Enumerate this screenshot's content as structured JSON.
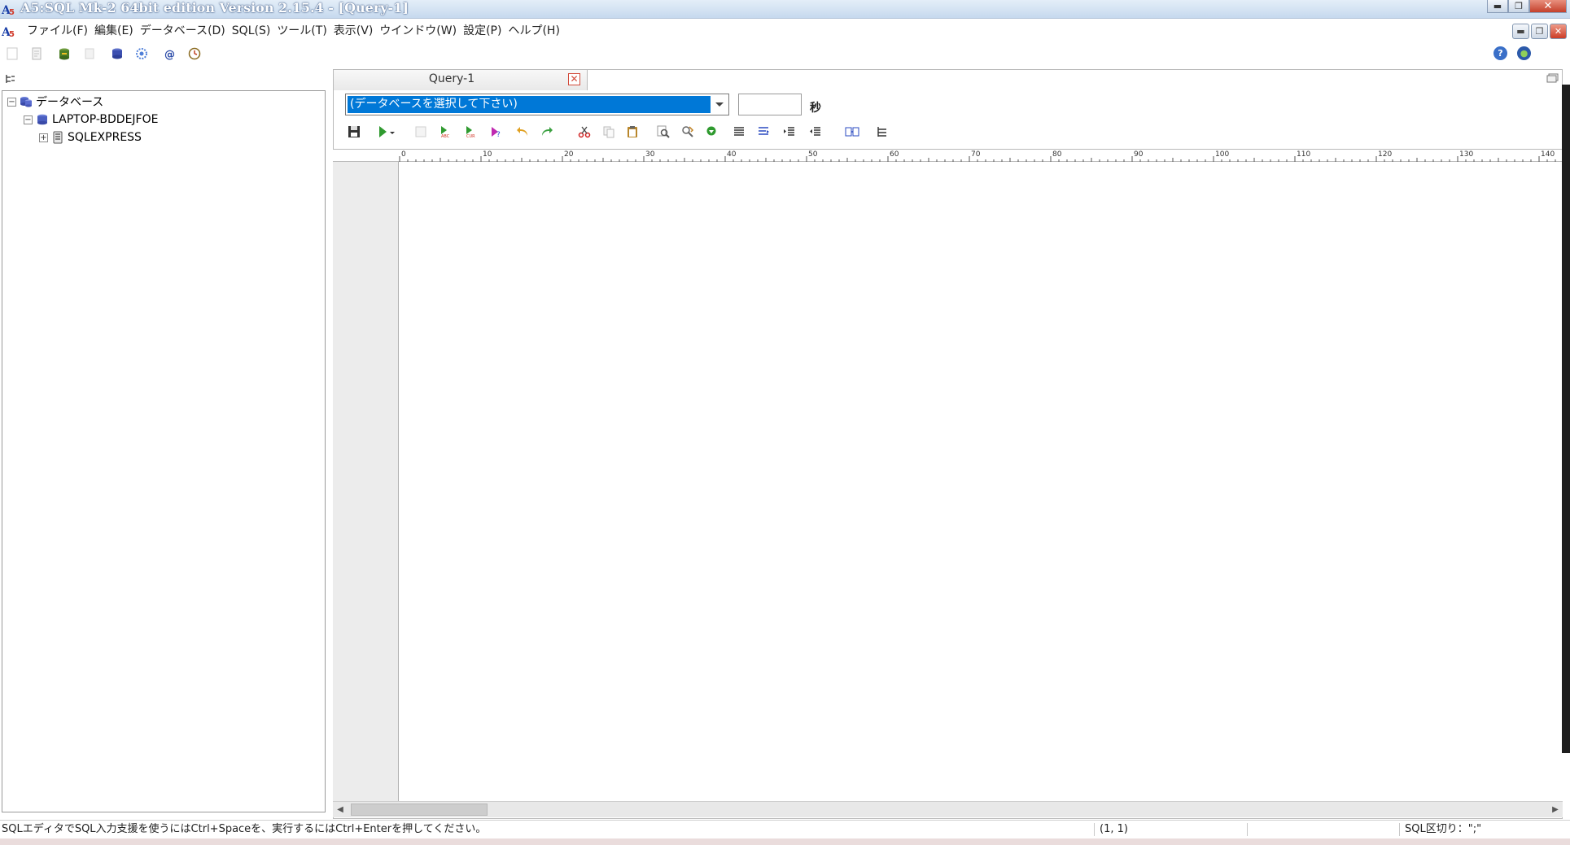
{
  "window": {
    "title": "A5:SQL Mk-2 64bit edition Version 2.15.4 - [Query-1]",
    "minimize_glyph": "▬",
    "maximize_glyph": "❐",
    "close_glyph": "✕"
  },
  "menu": {
    "items": [
      {
        "label": "ファイル(F)"
      },
      {
        "label": "編集(E)"
      },
      {
        "label": "データベース(D)"
      },
      {
        "label": "SQL(S)"
      },
      {
        "label": "ツール(T)"
      },
      {
        "label": "表示(V)"
      },
      {
        "label": "ウインドウ(W)"
      },
      {
        "label": "設定(P)"
      },
      {
        "label": "ヘルプ(H)"
      }
    ]
  },
  "main_toolbar": {
    "icons": [
      "new-file-icon",
      "open-file-icon",
      "connect-database-icon",
      "disabled-icon",
      "database-icon",
      "settings-gear-icon",
      "at-sign-icon",
      "timer-icon"
    ],
    "help_icon_glyph": "?",
    "web_icon_glyph": "●"
  },
  "tree": {
    "root": {
      "label": "データベース",
      "expander": "−"
    },
    "server": {
      "label": "LAPTOP-BDDEJFOE",
      "expander": "−"
    },
    "instance": {
      "label": "SQLEXPRESS",
      "expander": "+"
    }
  },
  "editor": {
    "tab_label": "Query-1",
    "tab_close_glyph": "✕",
    "db_select_value": "(データベースを選択して下さい)",
    "timeout_value": "",
    "timeout_unit": "秒",
    "ruler_ticks": [
      "0",
      "10",
      "20",
      "30",
      "40",
      "50",
      "60",
      "70",
      "80",
      "90",
      "100",
      "110",
      "120",
      "130",
      "140"
    ]
  },
  "status": {
    "hint": "SQLエディタでSQL入力支援を使うにはCtrl+Spaceを、実行するにはCtrl+Enterを押してください。",
    "cursor_position": "(1, 1)",
    "sql_delimiter": "SQL区切り：\";\""
  },
  "colors": {
    "selection": "#0078d7",
    "gutter": "#ececec"
  }
}
